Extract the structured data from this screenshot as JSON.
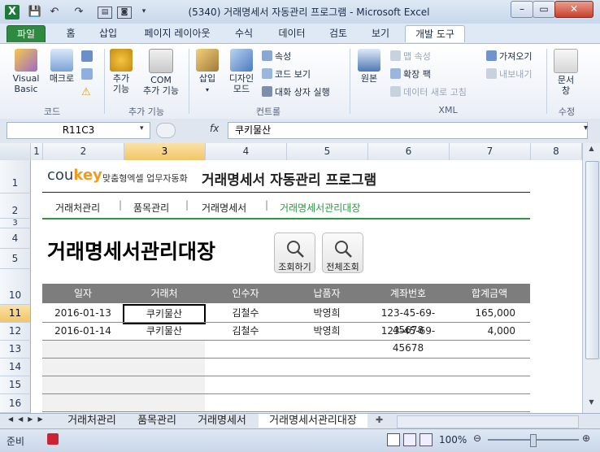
{
  "window": {
    "title": "(5340) 거래명세서 자동관리 프로그램  -  Microsoft Excel",
    "app_icon": "X",
    "minimize": "–",
    "restore": "▭",
    "close": "✕"
  },
  "ribbon_tabs": [
    "파일",
    "홈",
    "삽입",
    "페이지 레이아웃",
    "수식",
    "데이터",
    "검토",
    "보기",
    "개발 도구"
  ],
  "ribbon": {
    "code": {
      "label": "코드",
      "visual_basic": "Visual\nBasic",
      "macro": "매크로"
    },
    "addins": {
      "label": "추가 기능",
      "addins_btn": "추가\n기능",
      "com_addins": "COM\n추가 기능"
    },
    "controls": {
      "label": "컨트롤",
      "insert": "삽입",
      "design_mode": "디자인\n모드",
      "properties": "속성",
      "view_code": "코드 보기",
      "run_dialog": "대화 상자 실행"
    },
    "xml": {
      "label": "XML",
      "source": "원본",
      "map_properties": "맵 속성",
      "expansion_packs": "확장 팩",
      "refresh_data": "데이터 새로 고침",
      "import": "가져오기",
      "export": "내보내기"
    },
    "modify": {
      "label": "수정",
      "document_panel": "문서\n창"
    }
  },
  "formula_bar": {
    "name_box": "R11C3",
    "fx": "fx",
    "value": "쿠키물산"
  },
  "columns": [
    "1",
    "2",
    "3",
    "4",
    "5",
    "6",
    "7",
    "8"
  ],
  "rows": [
    "1",
    "2",
    "3",
    "4",
    "5",
    "10",
    "11",
    "12",
    "13",
    "14",
    "15",
    "16"
  ],
  "sheet": {
    "brand_cou": "cou",
    "brand_key": "key",
    "brand_sub": "맞춤형엑셀 업무자동화",
    "app_title": "거래명세서 자동관리 프로그램",
    "nav": [
      "거래처관리",
      "품목관리",
      "거래명세서",
      "거래명세서관리대장"
    ],
    "nav_sep": "|",
    "page_title": "거래명세서관리대장",
    "search_button": "조회하기",
    "view_all_button": "전체조회",
    "table_headers": [
      "일자",
      "거래처",
      "인수자",
      "납품자",
      "계좌번호",
      "합계금액"
    ],
    "table_rows": [
      [
        "2016-01-13",
        "쿠키물산",
        "김철수",
        "박영희",
        "123-45-69-45678",
        "165,000"
      ],
      [
        "2016-01-14",
        "쿠키물산",
        "김철수",
        "박영희",
        "123-45-69-45678",
        "4,000"
      ]
    ]
  },
  "sheet_tabs": [
    "거래처관리",
    "품목관리",
    "거래명세서",
    "거래명세서관리대장"
  ],
  "status": {
    "ready": "준비",
    "zoom": "100%"
  },
  "colors": {
    "accent_green": "#2a9a40",
    "header_grey": "#7d7d7d",
    "brand_orange": "#f39a1e"
  }
}
